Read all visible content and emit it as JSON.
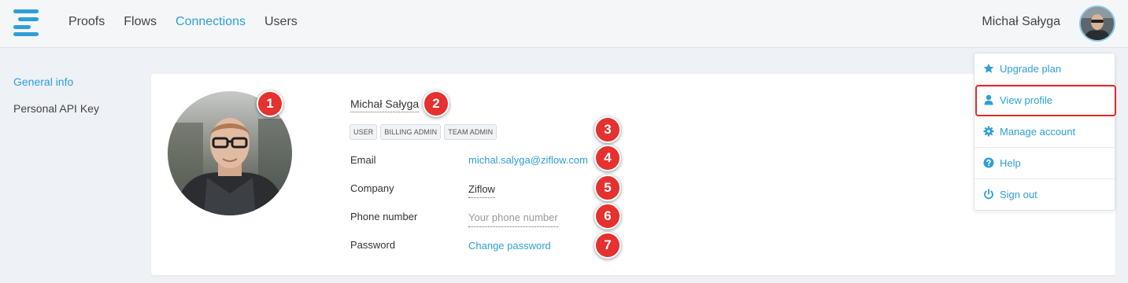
{
  "header": {
    "nav": [
      {
        "label": "Proofs"
      },
      {
        "label": "Flows"
      },
      {
        "label": "Connections"
      },
      {
        "label": "Users"
      }
    ],
    "user_name": "Michał Sałyga"
  },
  "sidebar": {
    "items": [
      {
        "label": "General info"
      },
      {
        "label": "Personal API Key"
      }
    ]
  },
  "profile": {
    "name": "Michał Sałyga",
    "roles": [
      "USER",
      "BILLING ADMIN",
      "TEAM ADMIN"
    ],
    "fields": {
      "email_label": "Email",
      "email_value": "michal.salyga@ziflow.com",
      "company_label": "Company",
      "company_value": "Ziflow",
      "phone_label": "Phone number",
      "phone_placeholder": "Your phone number",
      "password_label": "Password",
      "password_action": "Change password"
    }
  },
  "markers": [
    "1",
    "2",
    "3",
    "4",
    "5",
    "6",
    "7"
  ],
  "dropdown": {
    "items": [
      {
        "label": "Upgrade plan",
        "icon": "star-icon"
      },
      {
        "label": "View profile",
        "icon": "user-icon"
      },
      {
        "label": "Manage account",
        "icon": "gear-icon"
      },
      {
        "label": "Help",
        "icon": "question-icon"
      },
      {
        "label": "Sign out",
        "icon": "power-icon"
      }
    ]
  },
  "colors": {
    "accent": "#2e9fd8",
    "marker": "#e5312f",
    "highlight": "#e02a2a"
  }
}
